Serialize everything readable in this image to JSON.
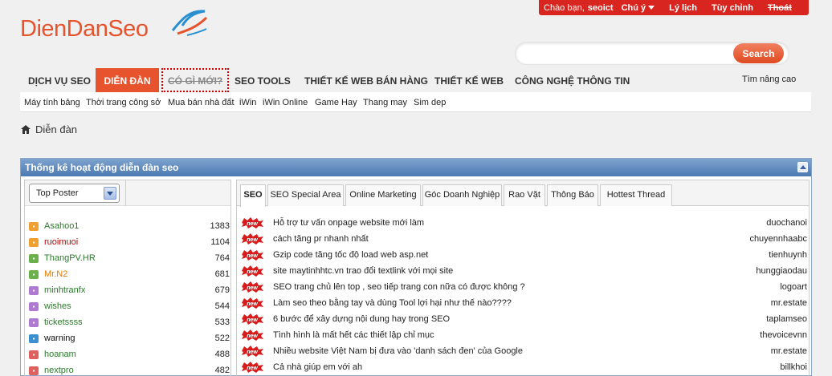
{
  "userbar": {
    "greeting": "Chào bạn,",
    "username": "seoict",
    "notice": "Chú ý",
    "history": "Lý lịch",
    "settings": "Tùy chỉnh",
    "logout": "Thoát"
  },
  "logo": {
    "text": "DienDanSeo"
  },
  "search": {
    "placeholder": "",
    "button": "Search",
    "advanced": "Tìm nâng cao"
  },
  "nav": {
    "tabs": [
      {
        "label": "DỊCH VỤ SEO"
      },
      {
        "label": "DIỄN ĐÀN"
      },
      {
        "label": "CÓ GÌ MỚI?"
      },
      {
        "label": "SEO TOOLS"
      },
      {
        "label": "THIẾT KẾ WEB BÁN HÀNG"
      },
      {
        "label": "THIẾT KẾ WEB"
      },
      {
        "label": "CÔNG NGHỆ THÔNG TIN"
      }
    ],
    "active": "DIỄN ĐÀN"
  },
  "subnav": {
    "items": [
      {
        "label": "Máy tính bảng"
      },
      {
        "label": "Thời trang công sở"
      },
      {
        "label": "Mua bán nhà đất"
      },
      {
        "label": "iWin"
      },
      {
        "label": "iWin Online"
      },
      {
        "label": "Game Hay"
      },
      {
        "label": "Thang may"
      },
      {
        "label": "Sim dep"
      }
    ]
  },
  "breadcrumb": {
    "label": "Diễn đàn"
  },
  "panel": {
    "title": "Thống kê hoạt động diễn đàn seo",
    "poster_select": "Top Poster",
    "posters": [
      {
        "name": "Asahoo1",
        "count": "1383",
        "color": "#2a7a2a",
        "badge_color": "#f0a030"
      },
      {
        "name": "ruoimuoi",
        "count": "1104",
        "color": "#c00000",
        "badge_color": "#f0a030"
      },
      {
        "name": "ThangPV.HR",
        "count": "764",
        "color": "#2a7a2a",
        "badge_color": "#6ab04c"
      },
      {
        "name": "Mr.N2",
        "count": "681",
        "color": "#e07a00",
        "badge_color": "#6ab04c"
      },
      {
        "name": "minhtranfx",
        "count": "679",
        "color": "#2a7a2a",
        "badge_color": "#b07ad0"
      },
      {
        "name": "wishes",
        "count": "544",
        "color": "#2a7a2a",
        "badge_color": "#b07ad0"
      },
      {
        "name": "ticketssss",
        "count": "533",
        "color": "#2a7a2a",
        "badge_color": "#b07ad0"
      },
      {
        "name": "warning",
        "count": "522",
        "color": "#111111",
        "badge_color": "#3a8fd0"
      },
      {
        "name": "hoanam",
        "count": "488",
        "color": "#2a7a2a",
        "badge_color": "#e06060"
      },
      {
        "name": "nextpro",
        "count": "482",
        "color": "#2a7a2a",
        "badge_color": "#e06060"
      }
    ],
    "tabs": [
      {
        "label": "SEO"
      },
      {
        "label": "SEO Special Area"
      },
      {
        "label": "Online Marketing"
      },
      {
        "label": "Góc Doanh Nghiệp"
      },
      {
        "label": "Rao Vặt"
      },
      {
        "label": "Thông Báo"
      },
      {
        "label": "Hottest Thread"
      }
    ],
    "active_tab": "SEO",
    "new_badge": "new",
    "threads": [
      {
        "title": "Hỗ trợ tư vấn onpage website mới làm",
        "author": "duochanoi"
      },
      {
        "title": "cách tăng pr nhanh nhất",
        "author": "chuyennhaabc"
      },
      {
        "title": "Gzip code tăng tốc độ load web asp.net",
        "author": "tienhuynh"
      },
      {
        "title": "site maytinhhtc.vn trao đổi textlink với mọi site",
        "author": "hunggiaodau"
      },
      {
        "title": "SEO trang chủ lên top , seo tiếp trang con nữa có được không ?",
        "author": "logoart"
      },
      {
        "title": "Làm seo theo bằng tay và dùng Tool lợi hại như thế nào????",
        "author": "mr.estate"
      },
      {
        "title": "6 bước để xây dựng nội dung hay trong SEO",
        "author": "taplamseo"
      },
      {
        "title": "Tình hình là mất hết các thiết lập chỉ mục",
        "author": "thevoicevnn"
      },
      {
        "title": "Nhiều website Việt Nam bị đưa vào 'danh sách đen' của Google",
        "author": "mr.estate"
      },
      {
        "title": "Cả nhà giúp em với ah",
        "author": "billkhoi"
      }
    ]
  },
  "colors": {
    "accent": "#e6532c",
    "userbar": "#d8251f",
    "panel_header": "#4b79b2"
  }
}
